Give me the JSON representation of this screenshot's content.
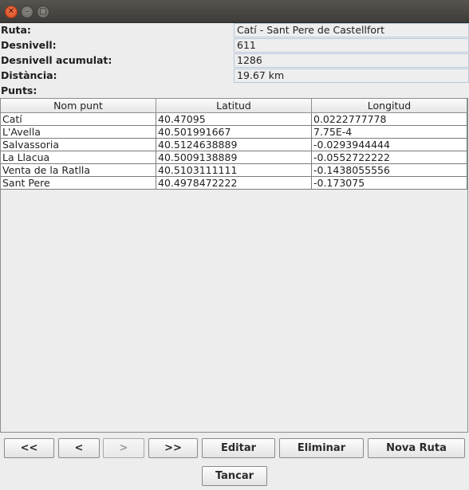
{
  "window": {
    "close_icon": "✕",
    "min_icon": "–",
    "max_icon": "□"
  },
  "info": {
    "ruta_label": "Ruta:",
    "ruta_value": "Catí - Sant Pere de Castellfort",
    "desnivell_label": "Desnivell:",
    "desnivell_value": "611",
    "desnivell_acum_label": "Desnivell acumulat:",
    "desnivell_acum_value": "1286",
    "distancia_label": "Distància:",
    "distancia_value": "19.67 km",
    "punts_label": "Punts:"
  },
  "table": {
    "headers": [
      "Nom punt",
      "Latitud",
      "Longitud"
    ],
    "rows": [
      [
        "Catí",
        "40.47095",
        "0.0222777778"
      ],
      [
        "L'Avella",
        "40.501991667",
        "7.75E-4"
      ],
      [
        "Salvassoria",
        "40.5124638889",
        "-0.0293944444"
      ],
      [
        "La Llacua",
        "40.5009138889",
        "-0.0552722222"
      ],
      [
        "Venta de la Ratlla",
        "40.5103111111",
        "-0.1438055556"
      ],
      [
        "Sant Pere",
        "40.4978472222",
        "-0.173075"
      ]
    ]
  },
  "buttons": {
    "first": "<<",
    "prev": "<",
    "next": ">",
    "last": ">>",
    "edit": "Editar",
    "delete": "Eliminar",
    "new_route": "Nova Ruta",
    "close": "Tancar"
  }
}
